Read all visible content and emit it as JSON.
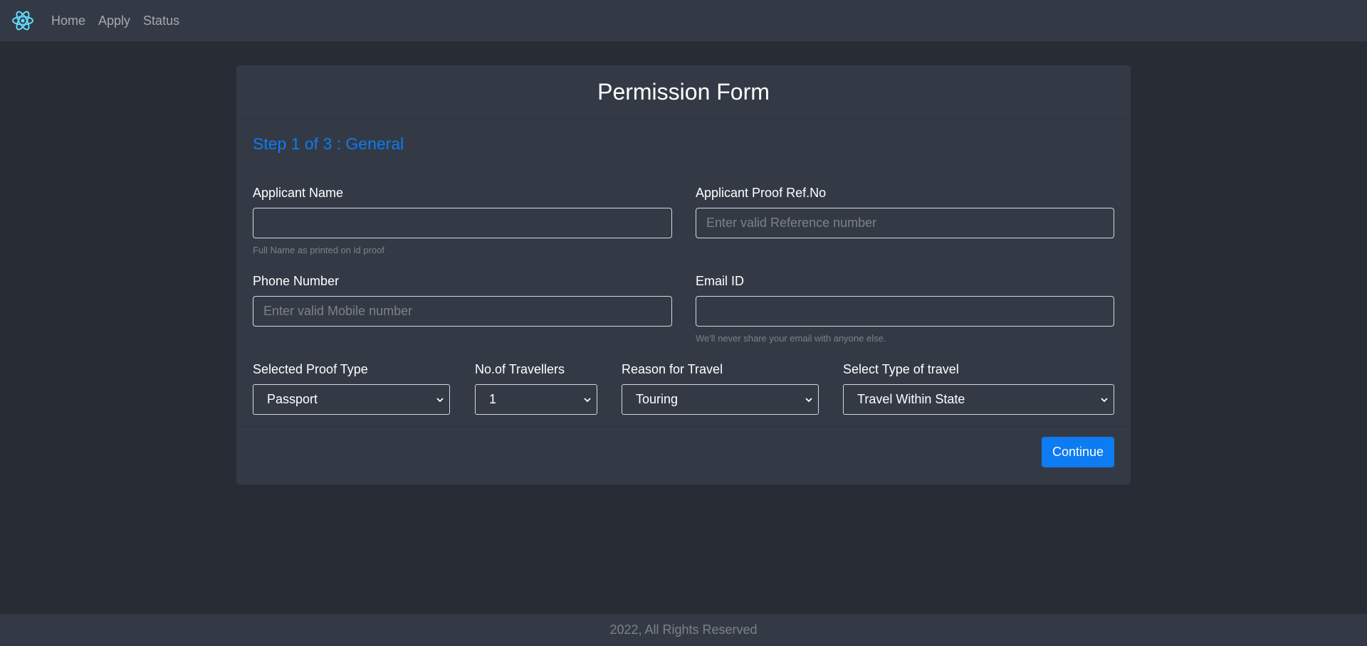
{
  "nav": {
    "logo_icon": "react-logo-icon",
    "links": [
      "Home",
      "Apply",
      "Status"
    ]
  },
  "form": {
    "title": "Permission Form",
    "step": "Step 1 of 3 : General",
    "applicant_name": {
      "label": "Applicant Name",
      "value": "",
      "placeholder": "",
      "help": "Full Name as printed on id proof"
    },
    "proof_ref": {
      "label": "Applicant Proof Ref.No",
      "value": "",
      "placeholder": "Enter valid Reference number"
    },
    "phone": {
      "label": "Phone Number",
      "value": "",
      "placeholder": "Enter valid Mobile number"
    },
    "email": {
      "label": "Email ID",
      "value": "",
      "placeholder": "",
      "help": "We'll never share your email with anyone else."
    },
    "proof_type": {
      "label": "Selected Proof Type",
      "selected": "Passport"
    },
    "travellers": {
      "label": "No.of Travellers",
      "selected": "1"
    },
    "reason": {
      "label": "Reason for Travel",
      "selected": "Touring"
    },
    "travel_type": {
      "label": "Select Type of travel",
      "selected": "Travel Within State"
    },
    "continue_label": "Continue"
  },
  "footer": {
    "text": "2022, All Rights Reserved"
  },
  "colors": {
    "background": "#282c34",
    "panel": "#343a45",
    "accent": "#0d7bf2",
    "logo": "#61dafb"
  }
}
